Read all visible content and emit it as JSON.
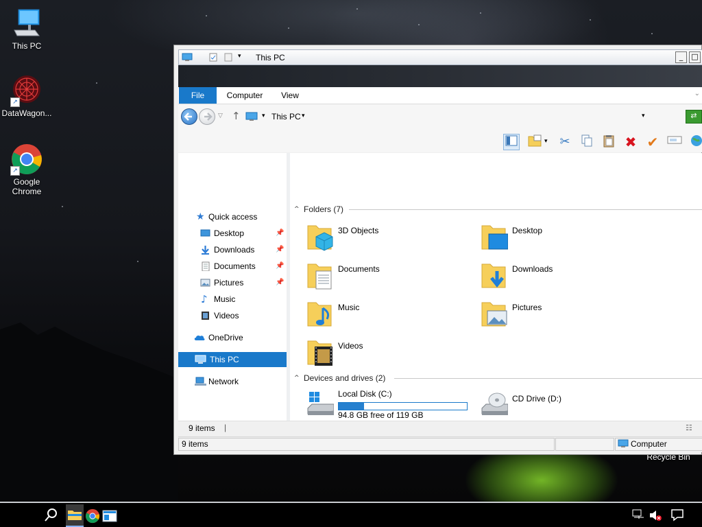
{
  "desktop": {
    "icons": [
      {
        "label": "This PC",
        "icon": "this-pc-icon"
      },
      {
        "label": "DataWagon...",
        "icon": "datawagon-icon"
      },
      {
        "label": "Google Chrome",
        "icon": "chrome-icon"
      }
    ],
    "recycle_bin_label": "Recycle Bin"
  },
  "window": {
    "title": "This PC",
    "minimize_glyph": "_",
    "maximize_glyph": "□",
    "tabs": [
      {
        "label": "File"
      },
      {
        "label": "Computer"
      },
      {
        "label": "View"
      }
    ],
    "address": {
      "location": "This PC"
    },
    "nav": {
      "quick_access": "Quick access",
      "pinned": [
        {
          "label": "Desktop",
          "pinned": true
        },
        {
          "label": "Downloads",
          "pinned": true
        },
        {
          "label": "Documents",
          "pinned": true
        },
        {
          "label": "Pictures",
          "pinned": true
        },
        {
          "label": "Music",
          "pinned": false
        },
        {
          "label": "Videos",
          "pinned": false
        }
      ],
      "onedrive": "OneDrive",
      "this_pc": "This PC",
      "network": "Network"
    },
    "folders_group": {
      "title": "Folders (7)"
    },
    "folders": [
      {
        "label": "3D Objects",
        "icon": "3d-objects-folder-icon"
      },
      {
        "label": "Desktop",
        "icon": "desktop-folder-icon"
      },
      {
        "label": "Documents",
        "icon": "documents-folder-icon"
      },
      {
        "label": "Downloads",
        "icon": "downloads-folder-icon"
      },
      {
        "label": "Music",
        "icon": "music-folder-icon"
      },
      {
        "label": "Pictures",
        "icon": "pictures-folder-icon"
      },
      {
        "label": "Videos",
        "icon": "videos-folder-icon"
      }
    ],
    "drives_group": {
      "title": "Devices and drives (2)"
    },
    "drives": [
      {
        "label": "Local Disk (C:)",
        "free_text": "94.8 GB free of 119 GB",
        "used_fraction": 0.2,
        "icon": "hard-drive-icon"
      },
      {
        "label": "CD Drive (D:)",
        "icon": "cd-drive-icon"
      }
    ],
    "status_items": "9 items",
    "status_bottom_items": "9 items",
    "status_location": "Computer"
  },
  "colors": {
    "accent": "#1979ca",
    "folder_yellow": "#f6cf5a"
  }
}
